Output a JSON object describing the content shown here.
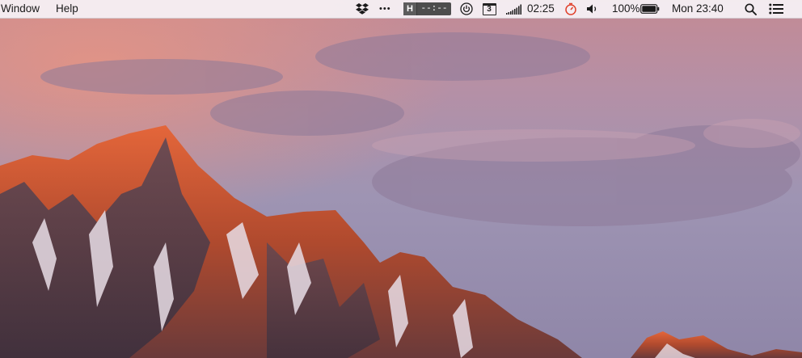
{
  "menubar": {
    "left_menus": [
      "Window",
      "Help"
    ],
    "status": {
      "icons": {
        "dropbox": "dropbox-icon",
        "more": "ellipsis-icon",
        "timer_app": "timer-app-icon",
        "power": "power-icon",
        "calendar": "calendar-icon",
        "signal": "signal-bars-icon",
        "stopwatch": "stopwatch-icon",
        "volume": "volume-icon",
        "battery": "battery-icon",
        "spotlight": "search-icon",
        "notifications": "list-icon"
      },
      "more_glyph": "•••",
      "timer_letter": "H",
      "timer_value": "--:--",
      "calendar_day": "3",
      "signal_time": "02:25",
      "battery_percent": "100%",
      "clock": "Mon 23:40"
    }
  },
  "colors": {
    "menubar_bg": "#f6f2f6",
    "timer_bg": "#4d4d4d",
    "stopwatch_accent": "#e0402a"
  }
}
